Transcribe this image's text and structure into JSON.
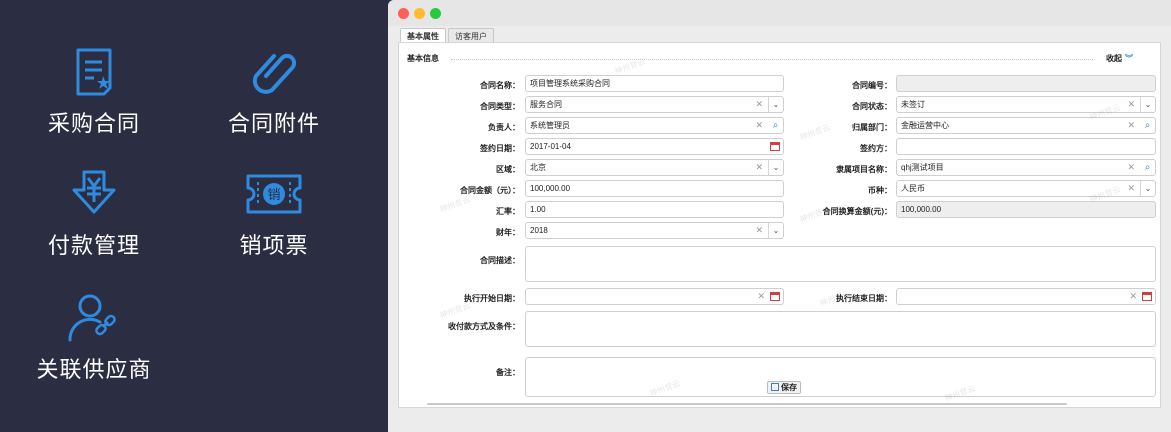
{
  "features": [
    {
      "icon": "contract-document-icon",
      "label": "采购合同"
    },
    {
      "icon": "paperclip-icon",
      "label": "合同附件"
    },
    {
      "icon": "yen-payment-icon",
      "label": "付款管理"
    },
    {
      "icon": "sales-invoice-ticket-icon",
      "label": "销项票",
      "badge": "销"
    },
    {
      "icon": "user-link-icon",
      "label": "关联供应商"
    }
  ],
  "colors": {
    "panel_bg": "#2b2d42",
    "icon_blue": "#2f8be0",
    "link_blue": "#3b8cd9"
  },
  "window": {
    "tabs": [
      "基本属性",
      "访客用户"
    ],
    "section_title": "基本信息",
    "collapse_label": "收起",
    "save_label": "保存"
  },
  "form": {
    "contract_name": {
      "label": "合同名称：",
      "value": "项目管理系统采购合同"
    },
    "contract_no": {
      "label": "合同编号：",
      "value": ""
    },
    "contract_type": {
      "label": "合同类型：",
      "value": "服务合同"
    },
    "contract_status": {
      "label": "合同状态：",
      "value": "未签订"
    },
    "owner": {
      "label": "负责人：",
      "value": "系统管理员"
    },
    "department": {
      "label": "归属部门：",
      "value": "金融运营中心"
    },
    "sign_date": {
      "label": "签约日期：",
      "value": "2017-01-04"
    },
    "signer": {
      "label": "签约方：",
      "value": ""
    },
    "region": {
      "label": "区域：",
      "value": "北京"
    },
    "project": {
      "label": "隶属项目名称：",
      "value": "qhj测试项目"
    },
    "amount": {
      "label": "合同金额（元）：",
      "value": "100,000.00"
    },
    "currency": {
      "label": "币种：",
      "value": "人民币"
    },
    "rate": {
      "label": "汇率：",
      "value": "1.00"
    },
    "converted_amount": {
      "label": "合同换算金额(元)：",
      "value": "100,000.00"
    },
    "fiscal_year": {
      "label": "财年：",
      "value": "2018"
    },
    "description": {
      "label": "合同描述："
    },
    "start_date": {
      "label": "执行开始日期：",
      "value": ""
    },
    "end_date": {
      "label": "执行结束日期：",
      "value": ""
    },
    "payment_terms": {
      "label": "收付款方式及条件："
    },
    "remark": {
      "label": "备注："
    }
  },
  "watermark": "神州昔云"
}
